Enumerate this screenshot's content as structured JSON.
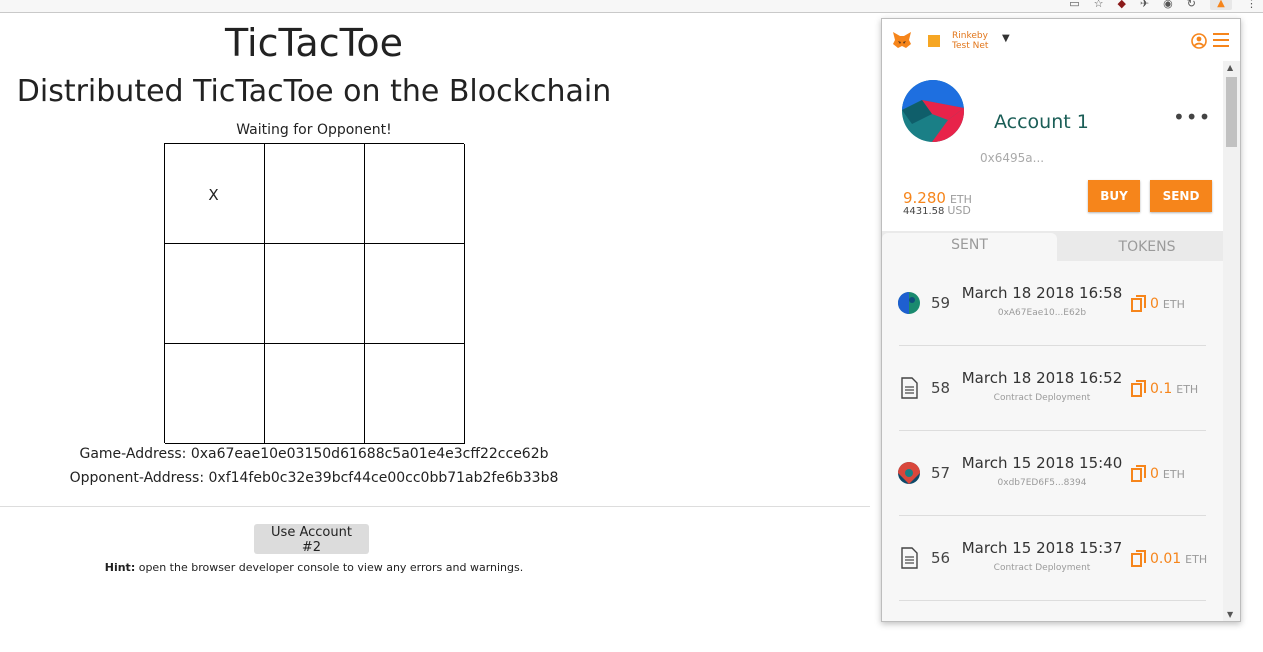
{
  "page": {
    "title": "TicTacToe",
    "subtitle": "Distributed TicTacToe on the Blockchain",
    "status": "Waiting for Opponent!",
    "board": [
      "X",
      "",
      "",
      "",
      "",
      "",
      "",
      "",
      ""
    ],
    "game_address": "Game-Address: 0xa67eae10e03150d61688c5a01e4e3cff22cce62b",
    "opponent_address": "Opponent-Address: 0xf14feb0c32e39bcf44ce00cc0bb71ab2fe6b33b8",
    "use_account_button": "Use Account #2",
    "hint_label": "Hint:",
    "hint_text": " open the browser developer console to view any errors and warnings."
  },
  "metamask": {
    "network_line1": "Rinkeby",
    "network_line2": "Test Net",
    "account_name": "Account 1",
    "account_address": "0x6495a...",
    "eth_balance": "9.280",
    "eth_unit": "ETH",
    "usd_balance": "4431.58",
    "usd_unit": "USD",
    "buy_label": "BUY",
    "send_label": "SEND",
    "tabs": {
      "sent": "SENT",
      "tokens": "TOKENS"
    },
    "transactions": [
      {
        "nonce": "59",
        "date": "March 18 2018 16:58",
        "sub": "0xA67Eae10...E62b",
        "amount": "0",
        "unit": "ETH",
        "icon": "address-identicon"
      },
      {
        "nonce": "58",
        "date": "March 18 2018 16:52",
        "sub": "Contract Deployment",
        "amount": "0.1",
        "unit": "ETH",
        "icon": "contract-document-icon"
      },
      {
        "nonce": "57",
        "date": "March 15 2018 15:40",
        "sub": "0xdb7ED6F5...8394",
        "amount": "0",
        "unit": "ETH",
        "icon": "address-identicon"
      },
      {
        "nonce": "56",
        "date": "March 15 2018 15:37",
        "sub": "Contract Deployment",
        "amount": "0.01",
        "unit": "ETH",
        "icon": "contract-document-icon"
      }
    ]
  },
  "colors": {
    "accent": "#f6851b",
    "account_name": "#1b5e57",
    "network": "#e2761b"
  }
}
